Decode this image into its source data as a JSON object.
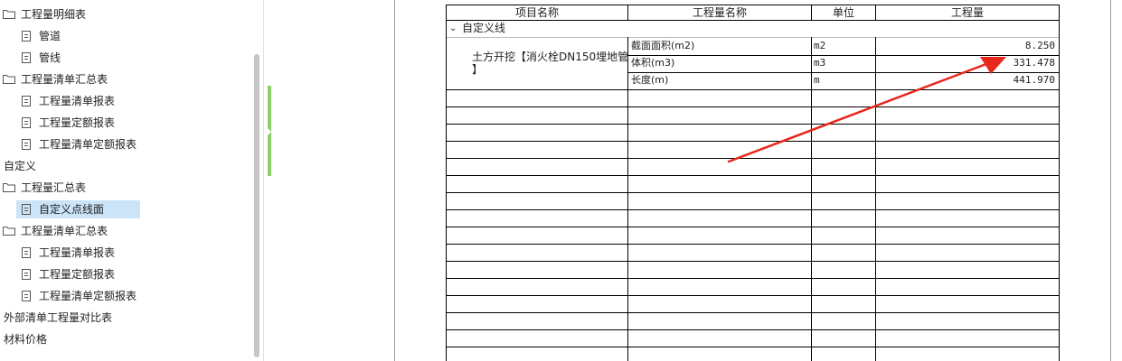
{
  "sidebar": {
    "items": [
      {
        "label": "工程量明细表",
        "type": "folder"
      },
      {
        "label": "管道",
        "type": "doc"
      },
      {
        "label": "管线",
        "type": "doc"
      },
      {
        "label": "工程量清单汇总表",
        "type": "folder"
      },
      {
        "label": "工程量清单报表",
        "type": "doc"
      },
      {
        "label": "工程量定额报表",
        "type": "doc"
      },
      {
        "label": "工程量清单定额报表",
        "type": "doc"
      },
      {
        "label": "自定义",
        "type": "section"
      },
      {
        "label": "工程量汇总表",
        "type": "folder"
      },
      {
        "label": "自定义点线面",
        "type": "doc",
        "selected": true
      },
      {
        "label": "工程量清单汇总表",
        "type": "folder"
      },
      {
        "label": "工程量清单报表",
        "type": "doc"
      },
      {
        "label": "工程量定额报表",
        "type": "doc"
      },
      {
        "label": "工程量清单定额报表",
        "type": "doc"
      },
      {
        "label": "外部清单工程量对比表",
        "type": "section"
      },
      {
        "label": "材料价格",
        "type": "section"
      }
    ]
  },
  "report": {
    "headers": [
      "项目名称",
      "工程量名称",
      "单位",
      "工程量"
    ],
    "group": "自定义线",
    "item_name_line1": "土方开挖【消火栓DN150埋地管",
    "item_name_line2": "】",
    "rows": [
      {
        "name": "截面面积(m2)",
        "unit": "m2",
        "qty": "8.250"
      },
      {
        "name": "体积(m3)",
        "unit": "m3",
        "qty": "331.478"
      },
      {
        "name": "长度(m)",
        "unit": "m",
        "qty": "441.970"
      }
    ]
  },
  "colors": {
    "selection": "#cce4f7",
    "annotation_arrow": "#e8261c",
    "splitter": "#8ccf6b"
  }
}
